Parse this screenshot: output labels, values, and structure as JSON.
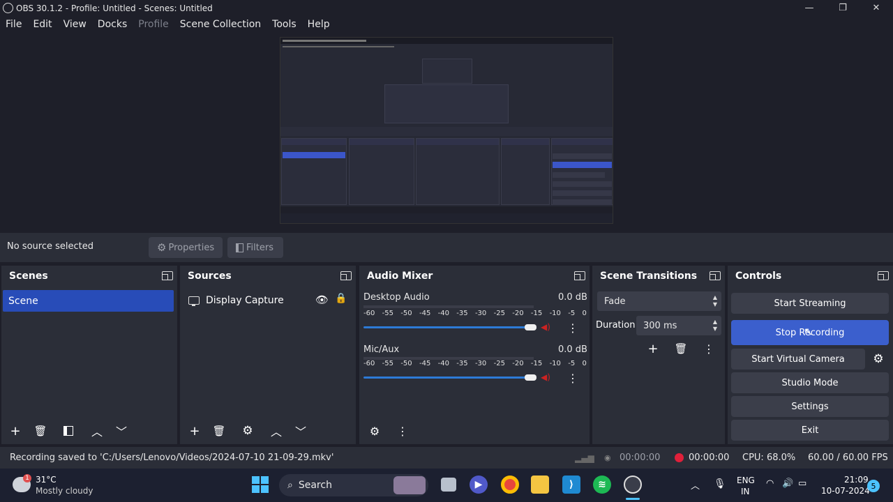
{
  "window": {
    "title": "OBS 30.1.2 - Profile: Untitled - Scenes: Untitled",
    "minimize": "—",
    "maximize": "❐",
    "close": "✕"
  },
  "menu": [
    "File",
    "Edit",
    "View",
    "Docks",
    "Profile",
    "Scene Collection",
    "Tools",
    "Help"
  ],
  "source_toolbar": {
    "status": "No source selected",
    "properties_label": "Properties",
    "filters_label": "Filters"
  },
  "scenes": {
    "title": "Scenes",
    "items": [
      "Scene"
    ]
  },
  "sources": {
    "title": "Sources",
    "items": [
      "Display Capture"
    ]
  },
  "audio_mixer": {
    "title": "Audio Mixer",
    "channels": [
      {
        "name": "Desktop Audio",
        "db": "0.0 dB",
        "volume": 0.98
      },
      {
        "name": "Mic/Aux",
        "db": "0.0 dB",
        "volume": 0.98
      }
    ],
    "scale": [
      "-60",
      "-55",
      "-50",
      "-45",
      "-40",
      "-35",
      "-30",
      "-25",
      "-20",
      "-15",
      "-10",
      "-5",
      "0"
    ]
  },
  "transitions": {
    "title": "Scene Transitions",
    "selected": "Fade",
    "duration_label": "Duration",
    "duration_value": "300 ms"
  },
  "controls": {
    "title": "Controls",
    "start_streaming": "Start Streaming",
    "stop_recording": "Stop Recording",
    "start_virtual_camera": "Start Virtual Camera",
    "studio_mode": "Studio Mode",
    "settings": "Settings",
    "exit": "Exit"
  },
  "status": {
    "message": "Recording saved to 'C:/Users/Lenovo/Videos/2024-07-10 21-09-29.mkv'",
    "stream_time": "00:00:00",
    "record_time": "00:00:00",
    "cpu": "CPU: 68.0%",
    "fps": "60.00 / 60.00 FPS",
    "record_color": "#e0203a"
  },
  "taskbar": {
    "weather_temp": "31°C",
    "weather_desc": "Mostly cloudy",
    "weather_badge": "1",
    "search_label": "Search",
    "lang": "ENG",
    "lang_region": "IN",
    "time": "21:09",
    "date": "10-07-2024",
    "notifications": "5"
  }
}
